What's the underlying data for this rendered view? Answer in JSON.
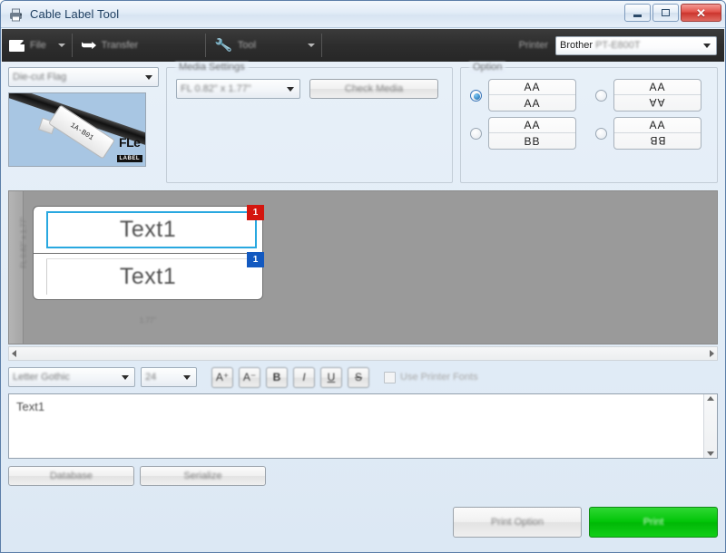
{
  "window": {
    "title": "Cable Label Tool",
    "controls": {
      "minimize": "–",
      "maximize": "□",
      "close": "✕"
    }
  },
  "ribbon": {
    "file": {
      "label": "File"
    },
    "transfer": {
      "label": "Transfer"
    },
    "tool": {
      "label": "Tool"
    },
    "printer": {
      "label": "Printer",
      "value_brand": "Brother",
      "value_model": "PT-E800T"
    }
  },
  "media": {
    "type_dropdown": "Die-cut Flag",
    "thumbnail_tag_text": "1A-B01",
    "thumbnail_logo_top": "FL",
    "thumbnail_logo_mark": "e",
    "thumbnail_logo_bottom": "LABEL"
  },
  "media_settings": {
    "group_title": "Media Settings",
    "size_dropdown": "FL 0.82\" x 1.77\"",
    "check_media_button": "Check Media"
  },
  "option": {
    "group_title": "Option",
    "items": [
      {
        "top": "AA",
        "bottom": "AA",
        "orientation": "normal",
        "selected": true
      },
      {
        "top": "AA",
        "bottom": "AA",
        "orientation": "flip-v",
        "selected": false
      },
      {
        "top": "AA",
        "bottom": "BB",
        "orientation": "normal",
        "selected": false
      },
      {
        "top": "AA",
        "bottom": "BB",
        "orientation": "flip-v",
        "selected": false
      }
    ]
  },
  "preview": {
    "vertical_measure": "FL 0.82\" x 1.77\"",
    "horizontal_measure": "1.77\"",
    "labels": [
      {
        "text": "Text1",
        "badge": "1",
        "badge_color": "#d4160f",
        "selected": true
      },
      {
        "text": "Text1",
        "badge": "1",
        "badge_color": "#1359c0",
        "selected": false
      }
    ]
  },
  "font_toolbar": {
    "font_family": "Letter Gothic",
    "font_size": "24",
    "buttons": [
      {
        "name": "increase-font-size",
        "glyph": "A⁺"
      },
      {
        "name": "decrease-font-size",
        "glyph": "A⁻"
      },
      {
        "name": "bold",
        "glyph": "B"
      },
      {
        "name": "italic",
        "glyph": "I"
      },
      {
        "name": "underline",
        "glyph": "U"
      },
      {
        "name": "strikethrough",
        "glyph": "S"
      }
    ],
    "use_printer_fonts_label": "Use Printer Fonts",
    "use_printer_fonts_checked": false
  },
  "editor": {
    "value": "Text1"
  },
  "actions": {
    "database": "Database",
    "serialize": "Serialize",
    "print_option": "Print Option",
    "print": "Print"
  },
  "colors": {
    "accent_selection": "#29a8e0",
    "print_green": "#00c407",
    "badge_red": "#d4160f",
    "badge_blue": "#1359c0"
  }
}
